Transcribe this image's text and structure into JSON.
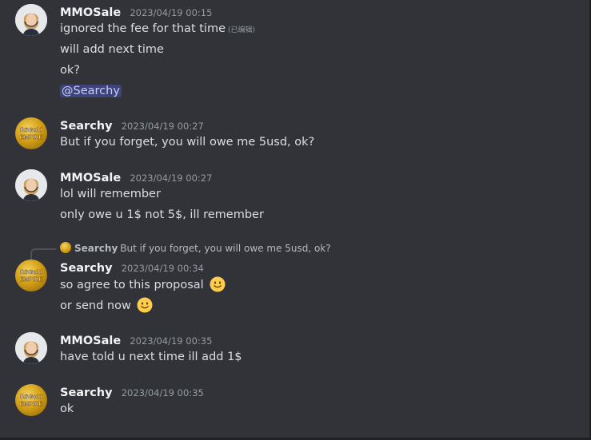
{
  "messages": [
    {
      "author": "MMOSale",
      "timestamp": "2023/04/19 00:15",
      "lines": [
        "ignored the fee for that time",
        "will add next time",
        "ok?",
        "@Searchy"
      ],
      "edited": "(已编辑)"
    },
    {
      "author": "Searchy",
      "timestamp": "2023/04/19 00:27",
      "lines": [
        "But if you forget, you will owe me 5usd, ok?"
      ]
    },
    {
      "author": "MMOSale",
      "timestamp": "2023/04/19 00:27",
      "lines": [
        "lol will remember",
        "only owe u 1$ not 5$, ill remember"
      ]
    },
    {
      "reply": {
        "author": "Searchy",
        "text": "But if you forget, you will owe me 5usd, ok?"
      },
      "author": "Searchy",
      "timestamp": "2023/04/19 00:34",
      "lines": [
        "so agree to this proposal",
        "or send now"
      ],
      "emoji": "slightly-smiling-face"
    },
    {
      "author": "MMOSale",
      "timestamp": "2023/04/19 00:35",
      "lines": [
        "have told u next time ill add 1$"
      ]
    },
    {
      "author": "Searchy",
      "timestamp": "2023/04/19 00:35",
      "lines": [
        "ok"
      ]
    }
  ],
  "avatar_text": {
    "rs_line1": "RSGold",
    "rs_line2": "EMPIRE"
  },
  "colors": {
    "background": "#313338",
    "username": "#f2f3f5",
    "timestamp": "#949ba4",
    "text": "#dbdee1",
    "mention_bg": "#4a5090",
    "mention_text": "#c9cdfb"
  }
}
